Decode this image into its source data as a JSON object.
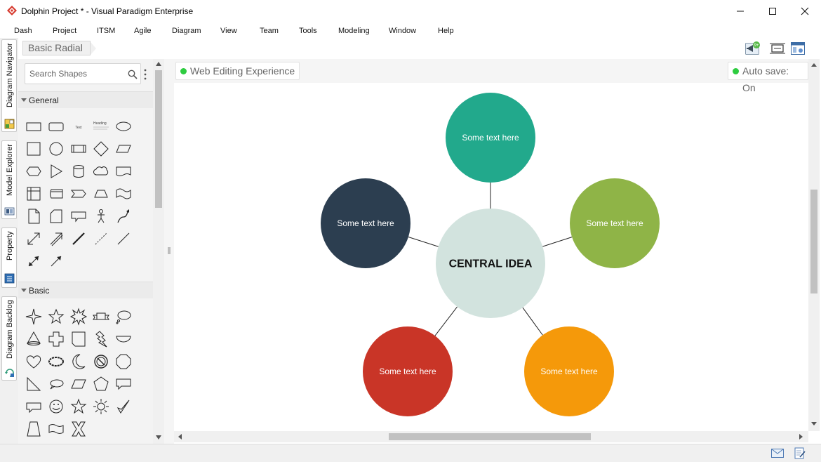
{
  "window": {
    "title": "Dolphin Project * - Visual Paradigm Enterprise"
  },
  "menu": {
    "items": [
      "Dash",
      "Project",
      "ITSM",
      "Agile",
      "Diagram",
      "View",
      "Team",
      "Tools",
      "Modeling",
      "Window",
      "Help"
    ]
  },
  "side_tabs": {
    "items": [
      {
        "label": "Diagram Navigator",
        "icon": "diagram-navigator-icon"
      },
      {
        "label": "Model Explorer",
        "icon": "model-explorer-icon"
      },
      {
        "label": "Property",
        "icon": "property-icon"
      },
      {
        "label": "Diagram Backlog",
        "icon": "diagram-backlog-icon"
      }
    ]
  },
  "breadcrumb": {
    "label": "Basic Radial"
  },
  "toolbar": {
    "notification_badge": "9+"
  },
  "shapes_panel": {
    "search_placeholder": "Search Shapes",
    "sections": {
      "general": "General",
      "basic": "Basic"
    },
    "general_text_shape": "Text",
    "general_heading_shape": "Heading"
  },
  "canvas": {
    "web_editing_label": "Web Editing Experience",
    "auto_save_label": "Auto save: On",
    "status_color": "#2ecc40"
  },
  "diagram": {
    "central": {
      "text": "CENTRAL IDEA",
      "color": "#d2e3de"
    },
    "nodes": [
      {
        "text": "Some text here",
        "color": "#22a98c"
      },
      {
        "text": "Some text here",
        "color": "#8fb447"
      },
      {
        "text": "Some text here",
        "color": "#f5990a"
      },
      {
        "text": "Some text here",
        "color": "#c93527"
      },
      {
        "text": "Some text here",
        "color": "#2c3e50"
      }
    ]
  }
}
